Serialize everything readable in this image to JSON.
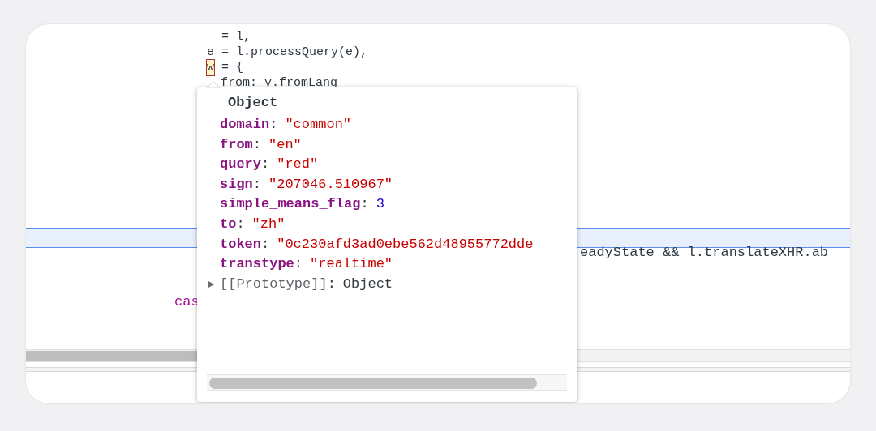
{
  "code": {
    "lines": [
      {
        "segments": [
          {
            "text": "_ = l,",
            "hovered": false
          }
        ]
      },
      {
        "segments": [
          {
            "text": "e = l.processQuery(e),",
            "hovered": false
          }
        ]
      },
      {
        "segments": [
          {
            "text": "w",
            "hovered": true
          },
          {
            "text": " = {",
            "hovered": false
          }
        ]
      },
      {
        "segments": [
          {
            "text": "from: y.fromLang",
            "hovered": false
          }
        ],
        "indented": true
      }
    ],
    "current_line": {
      "highlighted": true
    },
    "lower_lines": [
      {
        "text": "eadyState && l.translateXHR.ab",
        "kind": "plain"
      },
      {
        "text": "cas",
        "kind": "keyword"
      }
    ]
  },
  "popup": {
    "title": "Object",
    "separator": ":",
    "properties": [
      {
        "key": "domain",
        "value": "\"common\"",
        "kind": "string"
      },
      {
        "key": "from",
        "value": "\"en\"",
        "kind": "string"
      },
      {
        "key": "query",
        "value": "\"red\"",
        "kind": "string"
      },
      {
        "key": "sign",
        "value": "\"207046.510967\"",
        "kind": "string"
      },
      {
        "key": "simple_means_flag",
        "value": "3",
        "kind": "number"
      },
      {
        "key": "to",
        "value": "\"zh\"",
        "kind": "string"
      },
      {
        "key": "token",
        "value": "\"0c230afd3ad0ebe562d48955772dde",
        "kind": "string"
      },
      {
        "key": "transtype",
        "value": "\"realtime\"",
        "kind": "string"
      }
    ],
    "prototype": {
      "label": "[[Prototype]]",
      "value": "Object",
      "expanded": false
    }
  }
}
